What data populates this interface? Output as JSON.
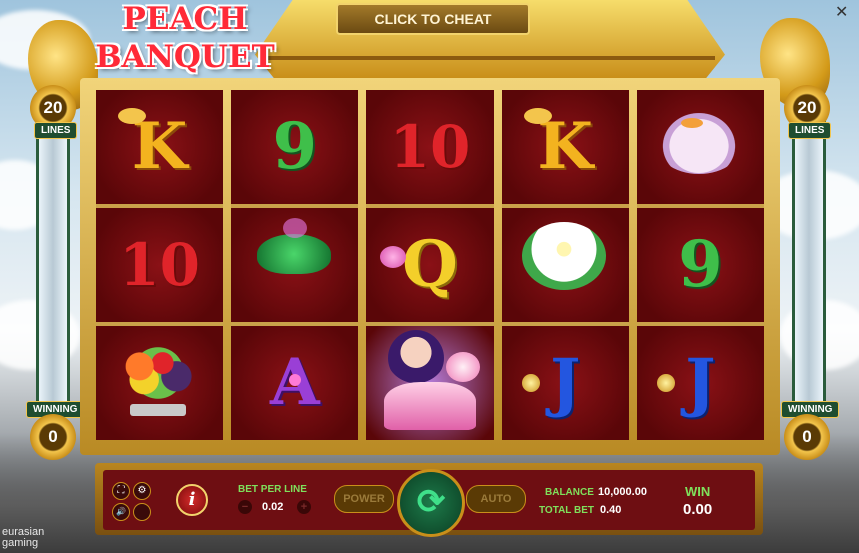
{
  "header": {
    "logo_line1": "PEACH",
    "logo_line2": "BANQUET",
    "cheat_button": "CLICK TO CHEAT",
    "close_glyph": "✕"
  },
  "lines": {
    "left_count": "20",
    "left_label": "LINES",
    "right_count": "20",
    "right_label": "LINES"
  },
  "winning": {
    "left_label": "WINNING",
    "left_value": "0",
    "right_label": "WINNING",
    "right_value": "0"
  },
  "reels": [
    [
      {
        "symbol": "K",
        "icon": "gold-ingot"
      },
      {
        "symbol": "10",
        "icon": ""
      },
      {
        "symbol": "",
        "icon": "fruit-bowl"
      }
    ],
    [
      {
        "symbol": "9",
        "icon": ""
      },
      {
        "symbol": "",
        "icon": "jade-cup"
      },
      {
        "symbol": "A",
        "icon": "pink-gem"
      }
    ],
    [
      {
        "symbol": "10",
        "icon": ""
      },
      {
        "symbol": "Q",
        "icon": "lotus"
      },
      {
        "symbol": "",
        "icon": "princess"
      }
    ],
    [
      {
        "symbol": "K",
        "icon": "gold-ingot"
      },
      {
        "symbol": "",
        "icon": "white-lotus"
      },
      {
        "symbol": "J",
        "icon": "cymbal"
      }
    ],
    [
      {
        "symbol": "",
        "icon": "jade-rabbit"
      },
      {
        "symbol": "9",
        "icon": ""
      },
      {
        "symbol": "J",
        "icon": "cymbal"
      }
    ]
  ],
  "controls": {
    "bet_per_line_label": "BET PER LINE",
    "bet_per_line_value": "0.02",
    "minus": "−",
    "plus": "+",
    "power_label": "POWER",
    "spin_glyph": "⟳",
    "auto_label": "AUTO",
    "balance_label": "BALANCE",
    "balance_value": "10,000.00",
    "total_bet_label": "TOTAL BET",
    "total_bet_value": "0.40",
    "win_label": "WIN",
    "win_value": "0.00",
    "info_glyph": "i",
    "fullscreen_glyph": "⛶",
    "settings_glyph": "⚙",
    "sound_glyph": "🔊"
  },
  "brand": {
    "line1": "eurasian",
    "line2": "gaming"
  },
  "colors": {
    "accent_gold": "#f3c54c",
    "label_green": "#7fe05c",
    "reel_red": "#5a0608"
  }
}
